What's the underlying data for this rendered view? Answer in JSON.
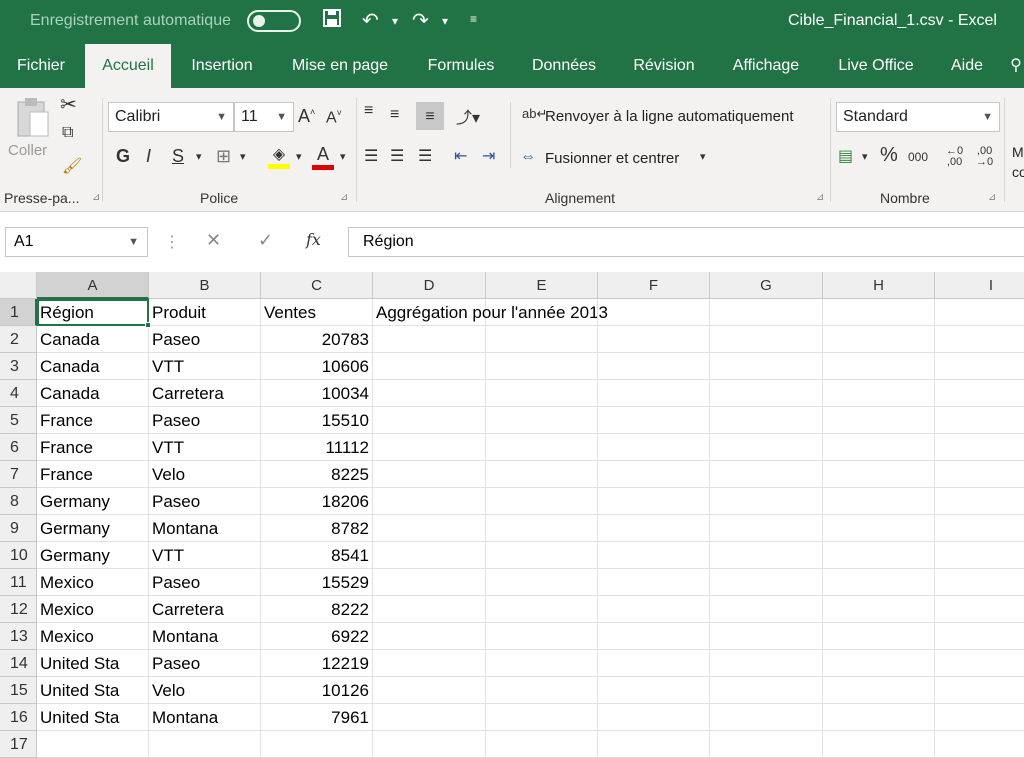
{
  "titlebar": {
    "autosave": "Enregistrement automatique",
    "document": "Cible_Financial_1.csv  -  Excel"
  },
  "tabs": [
    "Fichier",
    "Accueil",
    "Insertion",
    "Mise en page",
    "Formules",
    "Données",
    "Révision",
    "Affichage",
    "Live Office",
    "Aide"
  ],
  "ribbon": {
    "clipboard_label": "Presse-pa...",
    "paste_label": "Coller",
    "font_group": "Police",
    "font_name": "Calibri",
    "font_size": "11",
    "bold": "G",
    "italic": "I",
    "underline": "S",
    "align_group": "Alignement",
    "wrap_text": "Renvoyer à la ligne automatiquement",
    "merge_center": "Fusionner et centrer",
    "number_group": "Nombre",
    "number_format": "Standard",
    "percent": "%",
    "thousands": "000"
  },
  "formula": {
    "namebox": "A1",
    "fx": "fx",
    "content": "Région"
  },
  "columns": [
    "A",
    "B",
    "C",
    "D",
    "E",
    "F",
    "G",
    "H",
    "I"
  ],
  "rows": [
    [
      "Région",
      "Produit",
      "Ventes",
      "Aggrégation pour l'année 2013"
    ],
    [
      "Canada",
      "Paseo",
      "20783",
      ""
    ],
    [
      "Canada",
      "VTT",
      "10606",
      ""
    ],
    [
      "Canada",
      "Carretera",
      "10034",
      ""
    ],
    [
      "France",
      "Paseo",
      "15510",
      ""
    ],
    [
      "France",
      "VTT",
      "11112",
      ""
    ],
    [
      "France",
      "Velo",
      "8225",
      ""
    ],
    [
      "Germany",
      "Paseo",
      "18206",
      ""
    ],
    [
      "Germany",
      "Montana",
      "8782",
      ""
    ],
    [
      "Germany",
      "VTT",
      "8541",
      ""
    ],
    [
      "Mexico",
      "Paseo",
      "15529",
      ""
    ],
    [
      "Mexico",
      "Carretera",
      "8222",
      ""
    ],
    [
      "Mexico",
      "Montana",
      "6922",
      ""
    ],
    [
      "United Sta",
      "Paseo",
      "12219",
      ""
    ],
    [
      "United Sta",
      "Velo",
      "10126",
      ""
    ],
    [
      "United Sta",
      "Montana",
      "7961",
      ""
    ],
    [
      "",
      "",
      "",
      ""
    ]
  ],
  "colors": {
    "accent": "#217346"
  }
}
